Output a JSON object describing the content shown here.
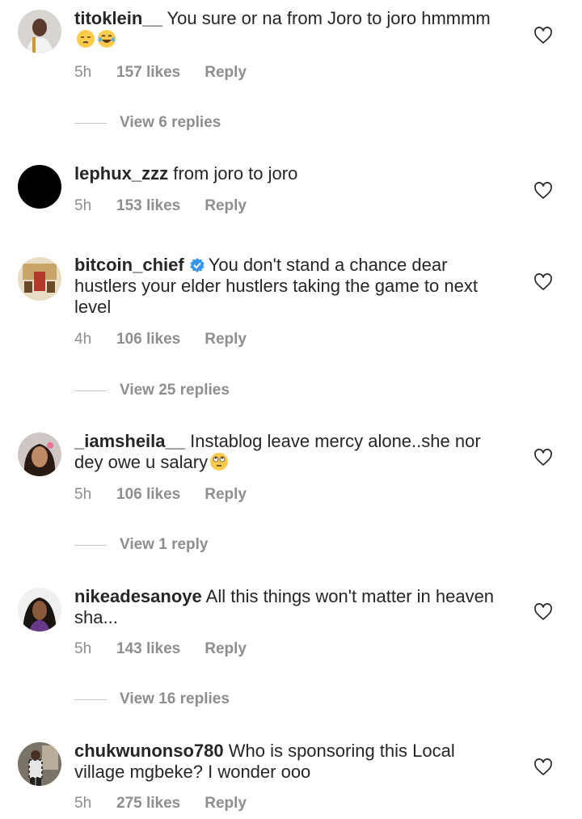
{
  "comments": [
    {
      "username": "titoklein__",
      "text": "You sure or na from Joro to joro hmmmm",
      "emoji": [
        "unamused-face",
        "tears-of-joy-face"
      ],
      "time": "5h",
      "likes": "157 likes",
      "reply": "Reply",
      "view_replies": "View 6 replies",
      "verified": false
    },
    {
      "username": "lephux_zzz",
      "text": "from joro to joro",
      "emoji": [],
      "time": "5h",
      "likes": "153 likes",
      "reply": "Reply",
      "view_replies": "",
      "verified": false
    },
    {
      "username": "bitcoin_chief",
      "text": "You don't stand a chance dear hustlers your elder hustlers taking the game to next level",
      "emoji": [],
      "time": "4h",
      "likes": "106 likes",
      "reply": "Reply",
      "view_replies": "View 25 replies",
      "verified": true
    },
    {
      "username": "_iamsheila__",
      "text": "Instablog leave mercy alone..she nor dey owe u salary",
      "emoji": [
        "face-with-rolling-eyes"
      ],
      "time": "5h",
      "likes": "106 likes",
      "reply": "Reply",
      "view_replies": "View 1 reply",
      "verified": false
    },
    {
      "username": "nikeadesanoye",
      "text": "All this things won't matter in heaven sha...",
      "emoji": [],
      "time": "5h",
      "likes": "143 likes",
      "reply": "Reply",
      "view_replies": "View 16 replies",
      "verified": false
    },
    {
      "username": "chukwunonso780",
      "text": "Who is sponsoring this Local village mgbeke? I wonder ooo",
      "emoji": [],
      "time": "5h",
      "likes": "275 likes",
      "reply": "Reply",
      "view_replies": "",
      "verified": false
    }
  ],
  "icons": {
    "like": "heart-outline-icon",
    "verified": "verified-badge-icon"
  },
  "colors": {
    "text": "#262626",
    "muted": "#8e8e8e",
    "verified": "#3897f0"
  }
}
